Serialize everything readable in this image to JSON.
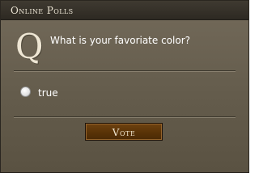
{
  "header": {
    "title": "Online Polls"
  },
  "poll": {
    "question_glyph": "Q",
    "question": "What is your favoriate color?",
    "options": [
      {
        "label": "true",
        "selected": false
      }
    ],
    "vote_label": "Vote"
  },
  "colors": {
    "background": "#665e4e",
    "header": "#332e26",
    "text": "#ffffff",
    "button": "#5a3408"
  }
}
